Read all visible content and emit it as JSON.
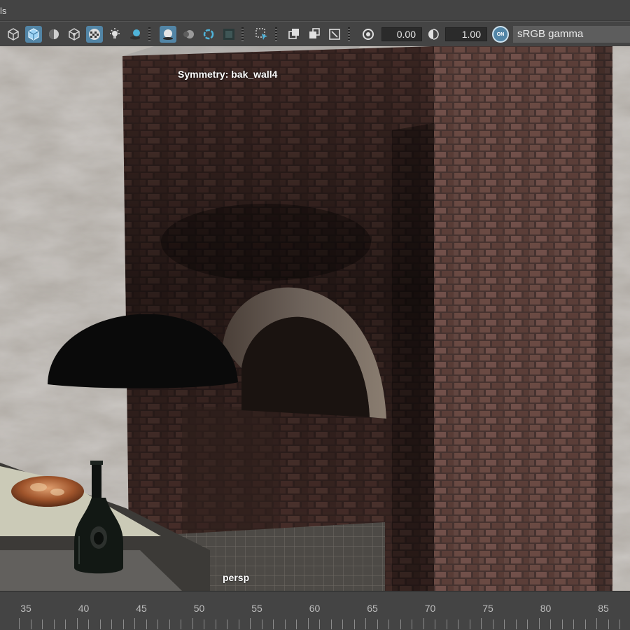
{
  "menubar": {
    "label": "ls"
  },
  "toolbar": {
    "icons": [
      "wireframe-cube-icon",
      "smooth-shaded-cube-icon",
      "wireframe-on-shaded-icon",
      "default-material-cube-icon",
      "textured-checker-icon",
      "lights-icon",
      "shadows-icon",
      "screen-space-ao-icon",
      "motion-blur-icon",
      "anti-alias-icon",
      "depth-of-field-icon",
      "isolate-select-icon",
      "xray-icon",
      "xray-active-icon",
      "xray-joints-icon",
      "exposure-icon",
      "gamma-icon"
    ],
    "exposure_value": "0.00",
    "gamma_value": "1.00",
    "color_management_badge": "ON",
    "color_space": "sRGB gamma"
  },
  "viewport": {
    "symmetry_label": "Symmetry: bak_wall4",
    "camera_label": "persp"
  },
  "timeline": {
    "ticks": [
      "35",
      "40",
      "45",
      "50",
      "55",
      "60",
      "65",
      "70",
      "75",
      "80",
      "85"
    ]
  },
  "colors": {
    "ui_background": "#444444",
    "active_highlight": "#5285a6",
    "field_background": "#2b2b2b"
  }
}
